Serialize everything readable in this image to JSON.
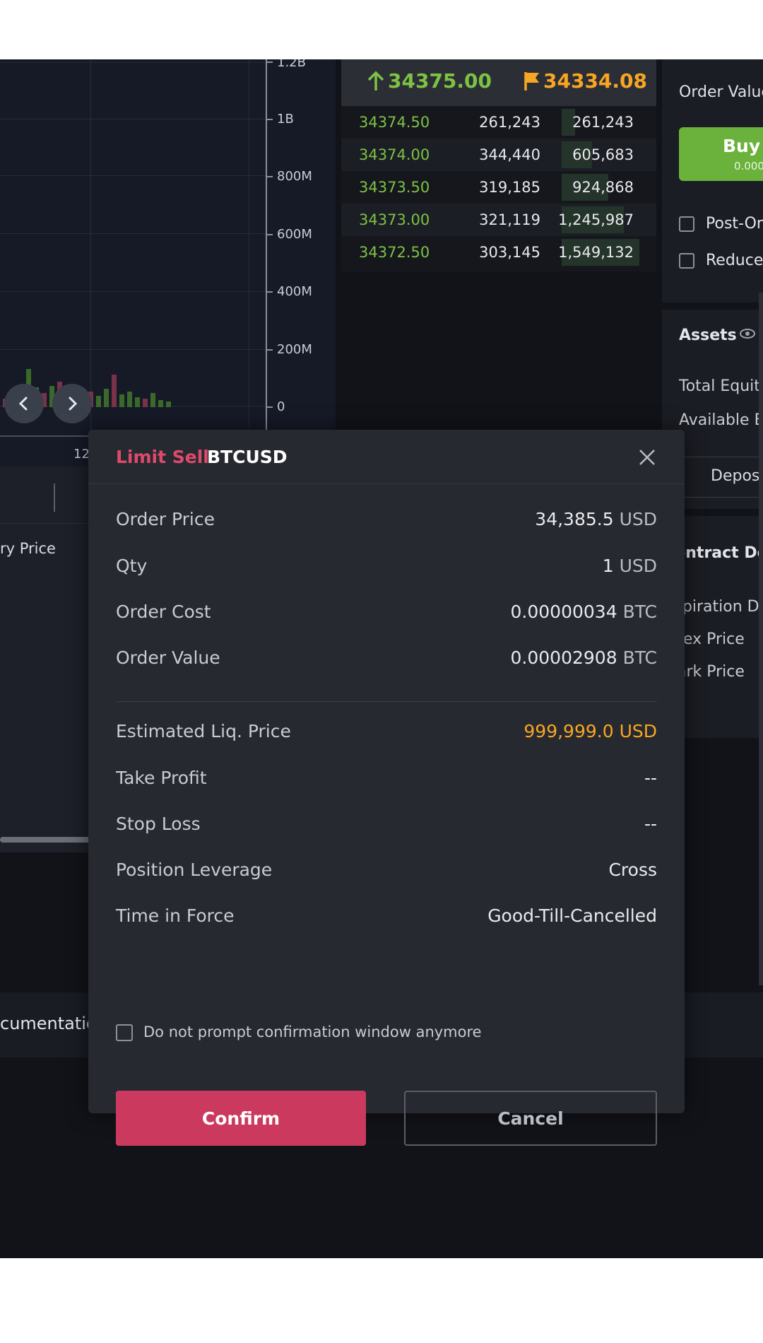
{
  "chart": {
    "y_ticks": [
      "1.2B",
      "1B",
      "800M",
      "600M",
      "400M",
      "200M",
      "0"
    ],
    "x_label": "12",
    "prev_icon": "chevron-left-icon",
    "next_icon": "chevron-right-icon"
  },
  "lower_left": {
    "column_label": "ry Price",
    "documentation_label": "cumentatio"
  },
  "orderbook": {
    "last_price": "34375.00",
    "mark_price": "34334.08",
    "last_price_color": "#7cc243",
    "mark_price_color": "#f7a623",
    "rows": [
      {
        "price": "34374.50",
        "size": "261,243",
        "total": "261,243",
        "depth": 0.17
      },
      {
        "price": "34374.00",
        "size": "344,440",
        "total": "605,683",
        "depth": 0.39
      },
      {
        "price": "34373.50",
        "size": "319,185",
        "total": "924,868",
        "depth": 0.6
      },
      {
        "price": "34373.00",
        "size": "321,119",
        "total": "1,245,987",
        "depth": 0.8
      },
      {
        "price": "34372.50",
        "size": "303,145",
        "total": "1,549,132",
        "depth": 1.0
      }
    ]
  },
  "right_panel": {
    "order_value_label": "Order Value",
    "buy_label": "Buy /",
    "buy_sub": "0.000",
    "post_only_label": "Post-On",
    "reduce_only_label": "Reduce-",
    "assets_label": "Assets",
    "total_equity_label": "Total Equity",
    "available_balance_label": "Available Ba",
    "deposit_label": "Deposi",
    "contract_details_label": "Contract De",
    "expiration_label": "Expiration D",
    "index_price_label": "ndex Price",
    "mark_price_label": "Mark Price"
  },
  "modal": {
    "side": "Limit Sell",
    "symbol": "BTCUSD",
    "side_color": "#de4a6d",
    "rows": [
      {
        "label": "Order Price",
        "value": "34,385.5",
        "unit": "USD"
      },
      {
        "label": "Qty",
        "value": "1",
        "unit": "USD"
      },
      {
        "label": "Order Cost",
        "value": "0.00000034",
        "unit": "BTC"
      },
      {
        "label": "Order Value",
        "value": "0.00002908",
        "unit": "BTC"
      }
    ],
    "rows2": [
      {
        "label": "Estimated Liq. Price",
        "value": "999,999.0 USD"
      },
      {
        "label": "Take Profit",
        "value": "--"
      },
      {
        "label": "Stop Loss",
        "value": "--"
      },
      {
        "label": "Position Leverage",
        "value": "Cross"
      },
      {
        "label": "Time in Force",
        "value": "Good-Till-Cancelled"
      }
    ],
    "liq_color": "#f7a623",
    "dont_prompt_label": "Do not prompt confirmation window anymore",
    "confirm_label": "Confirm",
    "cancel_label": "Cancel",
    "confirm_color": "#cb3a5e"
  }
}
